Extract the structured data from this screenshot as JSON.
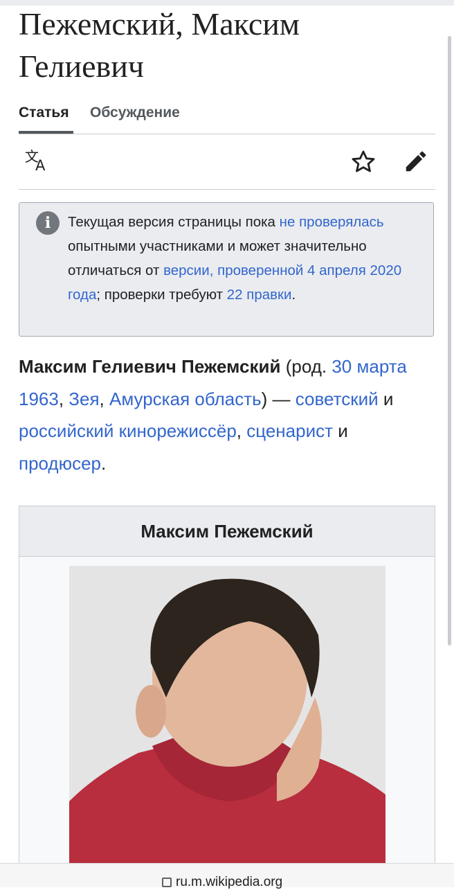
{
  "page": {
    "title": "Пежемский, Максим Гелиевич"
  },
  "tabs": [
    {
      "label": "Статья",
      "active": true
    },
    {
      "label": "Обсуждение",
      "active": false
    }
  ],
  "toolbar": {
    "icons": [
      "translate-icon",
      "star-icon",
      "edit-icon"
    ]
  },
  "notice": {
    "icon": "info-icon",
    "text_1": "Текущая версия страницы пока ",
    "link_1": "не проверялась",
    "text_2": " опытными участниками и может значительно отличаться от ",
    "link_2": "версии, проверенной 4 апреля 2020 года",
    "text_3": "; проверки требуют ",
    "link_3": "22 правки",
    "text_4": "."
  },
  "lead": {
    "name": "Максим Гелиевич Пежемский",
    "t1": " (род. ",
    "birth_date": "30 марта 1963",
    "t2": ", ",
    "place": "Зея",
    "t3": ", ",
    "region": "Амурская область",
    "t4": ") — ",
    "soviet": "советский",
    "t5": " и ",
    "role": "российский кинорежиссёр",
    "t6": ", ",
    "screenwriter": "сценарист",
    "t7": " и ",
    "producer": "продюсер",
    "t8": "."
  },
  "infobox": {
    "title": "Максим Пежемский"
  },
  "browser": {
    "url": "ru.m.wikipedia.org"
  },
  "colors": {
    "link": "#3366cc",
    "text": "#202122",
    "notice_bg": "#eaecf0"
  }
}
